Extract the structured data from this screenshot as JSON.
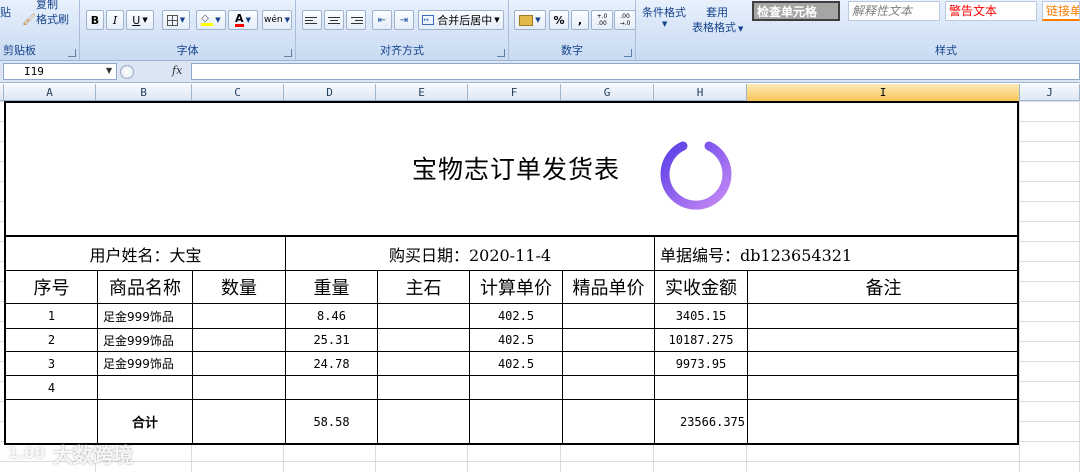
{
  "ribbon": {
    "clipboard": {
      "paste_label": "贴",
      "copy_label": "复制",
      "format_painter_label": "格式刷",
      "group_label": "剪贴板"
    },
    "font": {
      "bold": "B",
      "italic": "I",
      "underline": "U",
      "font_color_glyph": "A",
      "wen_glyph": "wén",
      "group_label": "字体"
    },
    "alignment": {
      "merge_center_label": "合并后居中",
      "group_label": "对齐方式"
    },
    "number": {
      "percent": "%",
      "comma": ",",
      "increase_decimal": "+.0 .00",
      "decrease_decimal": ".00 →.0",
      "group_label": "数字"
    },
    "styles": {
      "conditional_format_label": "条件格式",
      "apply_label": "套用",
      "table_format_label": "表格格式",
      "check_cell": "检查单元格",
      "explanatory_text": "解释性文本",
      "warning_text": "警告文本",
      "link_cell": "链接单",
      "group_label": "样式"
    }
  },
  "formula_bar": {
    "name_box": "I19",
    "fx": "fx",
    "value": ""
  },
  "columns": [
    "A",
    "B",
    "C",
    "D",
    "E",
    "F",
    "G",
    "H",
    "I",
    "J"
  ],
  "selected_column": "I",
  "invoice": {
    "title": "宝物志订单发货表",
    "customer": "用户姓名：大宝",
    "purchase_date": "购买日期：2020-11-4",
    "doc_number": "单据编号：db123654321",
    "headers": [
      "序号",
      "商品名称",
      "数量",
      "重量",
      "主石",
      "计算单价",
      "精品单价",
      "实收金额",
      "备注"
    ],
    "rows": [
      {
        "no": "1",
        "name": "足金999饰品",
        "qty": "",
        "weight": "8.46",
        "stone": "",
        "unit_price": "402.5",
        "fine_price": "",
        "amount": "3405.15",
        "note": ""
      },
      {
        "no": "2",
        "name": "足金999饰品",
        "qty": "",
        "weight": "25.31",
        "stone": "",
        "unit_price": "402.5",
        "fine_price": "",
        "amount": "10187.275",
        "note": ""
      },
      {
        "no": "3",
        "name": "足金999饰品",
        "qty": "",
        "weight": "24.78",
        "stone": "",
        "unit_price": "402.5",
        "fine_price": "",
        "amount": "9973.95",
        "note": ""
      },
      {
        "no": "4",
        "name": "",
        "qty": "",
        "weight": "",
        "stone": "",
        "unit_price": "",
        "fine_price": "",
        "amount": "",
        "note": ""
      }
    ],
    "total": {
      "label": "合计",
      "weight": "58.58",
      "amount": "23566.375"
    }
  },
  "logo": {
    "name": "ring-logo",
    "color_start": "#5b3ee8",
    "color_end": "#c78af5"
  },
  "watermark": {
    "text": "大数跨境",
    "logo_text": "1.00"
  }
}
